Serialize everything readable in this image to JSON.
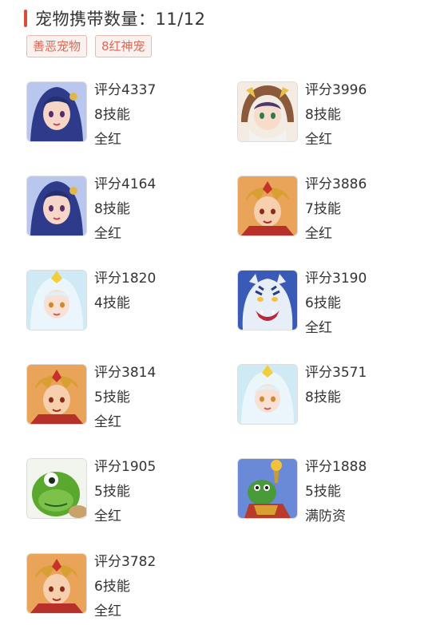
{
  "header": {
    "title": "宠物携带数量：11/12",
    "accent_color": "#d94b3b"
  },
  "tags": [
    "善恶宠物",
    "8红神宠"
  ],
  "pets": [
    {
      "icon": "dark-haired-girl-portrait",
      "lines": [
        "评分4337",
        "8技能",
        "全红"
      ]
    },
    {
      "icon": "hooded-girl-portrait",
      "lines": [
        "评分3996",
        "8技能",
        "全红"
      ]
    },
    {
      "icon": "dark-haired-girl-portrait",
      "lines": [
        "评分4164",
        "8技能",
        "全红"
      ]
    },
    {
      "icon": "golden-warrior-portrait",
      "lines": [
        "评分3886",
        "7技能",
        "全红"
      ]
    },
    {
      "icon": "white-haired-girl-portrait",
      "lines": [
        "评分1820",
        "4技能"
      ]
    },
    {
      "icon": "white-tiger-portrait",
      "lines": [
        "评分3190",
        "6技能",
        "全红"
      ]
    },
    {
      "icon": "golden-warrior-portrait",
      "lines": [
        "评分3814",
        "5技能",
        "全红"
      ]
    },
    {
      "icon": "white-haired-girl-portrait",
      "lines": [
        "评分3571",
        "8技能"
      ]
    },
    {
      "icon": "green-turtle-portrait",
      "lines": [
        "评分1905",
        "5技能",
        "全红"
      ]
    },
    {
      "icon": "turtle-warrior-portrait",
      "lines": [
        "评分1888",
        "5技能",
        "满防资"
      ]
    },
    {
      "icon": "golden-warrior-portrait",
      "lines": [
        "评分3782",
        "6技能",
        "全红"
      ]
    }
  ]
}
